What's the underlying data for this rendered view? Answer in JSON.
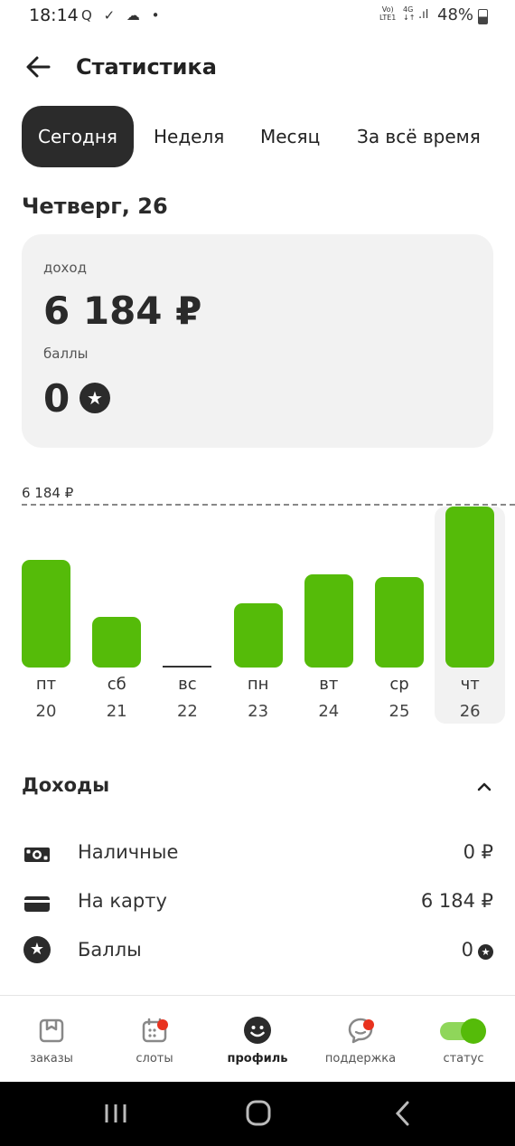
{
  "status_bar": {
    "time": "18:14",
    "left_icons": "Q ✓ ☁ •",
    "net_top": "Vo)",
    "net_bottom": "LTE1",
    "net2_top": "4G",
    "net2_bottom": "↓↑",
    "battery": "48%"
  },
  "header": {
    "title": "Статистика",
    "back_icon": "arrow-left-icon"
  },
  "tabs": [
    {
      "label": "Сегодня",
      "active": true
    },
    {
      "label": "Неделя",
      "active": false
    },
    {
      "label": "Месяц",
      "active": false
    },
    {
      "label": "За всё время",
      "active": false
    }
  ],
  "day_title": "Четверг, 26",
  "summary": {
    "income_label": "доход",
    "income_value": "6 184 ₽",
    "points_label": "баллы",
    "points_value": "0",
    "points_icon": "star-icon"
  },
  "chart_data": {
    "type": "bar",
    "max_label": "6 184 ₽",
    "categories": [
      "пт",
      "сб",
      "вс",
      "пн",
      "вт",
      "ср",
      "чт"
    ],
    "dates": [
      "20",
      "21",
      "22",
      "23",
      "24",
      "25",
      "26"
    ],
    "values": [
      4150,
      1930,
      0,
      2460,
      3590,
      3470,
      6184
    ],
    "ylim": [
      0,
      6184
    ],
    "selected_index": 6,
    "colors": {
      "bar": "#55bb09",
      "zero_bar": "#333333",
      "highlight": "#f2f2f2"
    }
  },
  "income_section": {
    "title": "Доходы",
    "toggle_icon": "chevron-up-icon",
    "rows": [
      {
        "icon": "cash-icon",
        "label": "Наличные",
        "value": "0 ₽"
      },
      {
        "icon": "card-icon",
        "label": "На карту",
        "value": "6 184 ₽"
      },
      {
        "icon": "star-icon",
        "label": "Баллы",
        "value": "0"
      }
    ]
  },
  "bottom_nav": [
    {
      "label": "заказы",
      "icon": "orders-icon",
      "active": false
    },
    {
      "label": "слоты",
      "icon": "calendar-icon",
      "active": false,
      "badge": true
    },
    {
      "label": "профиль",
      "icon": "smile-icon",
      "active": true
    },
    {
      "label": "поддержка",
      "icon": "chat-icon",
      "active": false,
      "badge": true
    },
    {
      "label": "статус",
      "icon": "toggle-icon",
      "active": false,
      "toggle_on": true
    }
  ],
  "system_nav": {
    "recent": "recent-apps-icon",
    "home": "home-icon",
    "back": "back-icon"
  },
  "colors": {
    "accent": "#55bb09",
    "dark": "#2b2b2b",
    "badge": "#e8321e",
    "card": "#f2f2f2"
  }
}
